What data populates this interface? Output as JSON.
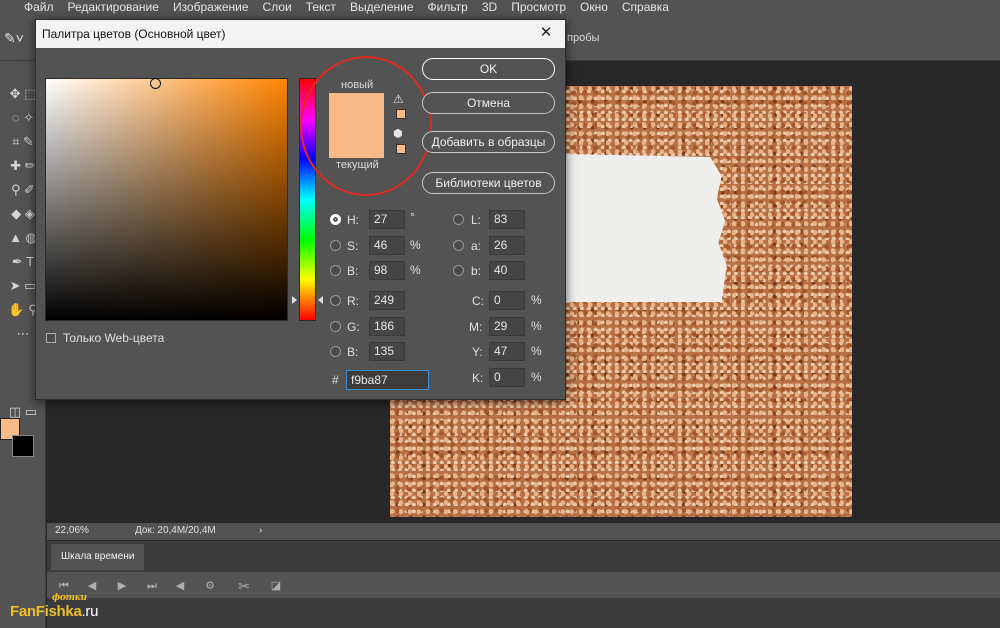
{
  "menu": [
    "Файл",
    "Редактирование",
    "Изображение",
    "Слои",
    "Текст",
    "Выделение",
    "Фильтр",
    "3D",
    "Просмотр",
    "Окно",
    "Справка"
  ],
  "options_bar": {
    "partial_text": "пробы",
    "tool_icon": "eyedropper-icon"
  },
  "foreground_color": "#f9ba87",
  "background_color": "#000000",
  "status": {
    "zoom": "22,06%",
    "doc": "Док: 20,4M/20,4M",
    "arrow": "›"
  },
  "timeline": {
    "tab": "Шкала времени"
  },
  "dialog": {
    "title": "Палитра цветов (Основной цвет)",
    "close": "✕",
    "label_new": "новый",
    "label_current": "текущий",
    "new_color": "#f9ba87",
    "current_color": "#f9ba87",
    "buttons": {
      "ok": "OK",
      "cancel": "Отмена",
      "add_to_swatches": "Добавить в образцы",
      "color_libraries": "Библиотеки цветов"
    },
    "hsb": {
      "h": {
        "label": "H:",
        "value": "27",
        "unit": "°",
        "selected": true
      },
      "s": {
        "label": "S:",
        "value": "46",
        "unit": "%"
      },
      "b": {
        "label": "B:",
        "value": "98",
        "unit": "%"
      }
    },
    "rgb": {
      "r": {
        "label": "R:",
        "value": "249"
      },
      "g": {
        "label": "G:",
        "value": "186"
      },
      "b": {
        "label": "B:",
        "value": "135"
      }
    },
    "lab": {
      "l": {
        "label": "L:",
        "value": "83"
      },
      "a": {
        "label": "a:",
        "value": "26"
      },
      "b": {
        "label": "b:",
        "value": "40"
      }
    },
    "cmyk": {
      "c": {
        "label": "C:",
        "value": "0",
        "unit": "%"
      },
      "m": {
        "label": "M:",
        "value": "29",
        "unit": "%"
      },
      "y": {
        "label": "Y:",
        "value": "47",
        "unit": "%"
      },
      "k": {
        "label": "K:",
        "value": "0",
        "unit": "%"
      }
    },
    "hex": {
      "label": "#",
      "value": "f9ba87"
    },
    "web_only": {
      "label": "Только Web-цвета",
      "checked": false
    },
    "highlight_color": "#e02820"
  },
  "watermark": {
    "fan": "Fan",
    "fishka": "Fishka",
    "ru": ".ru",
    "fotki": "фотки"
  }
}
